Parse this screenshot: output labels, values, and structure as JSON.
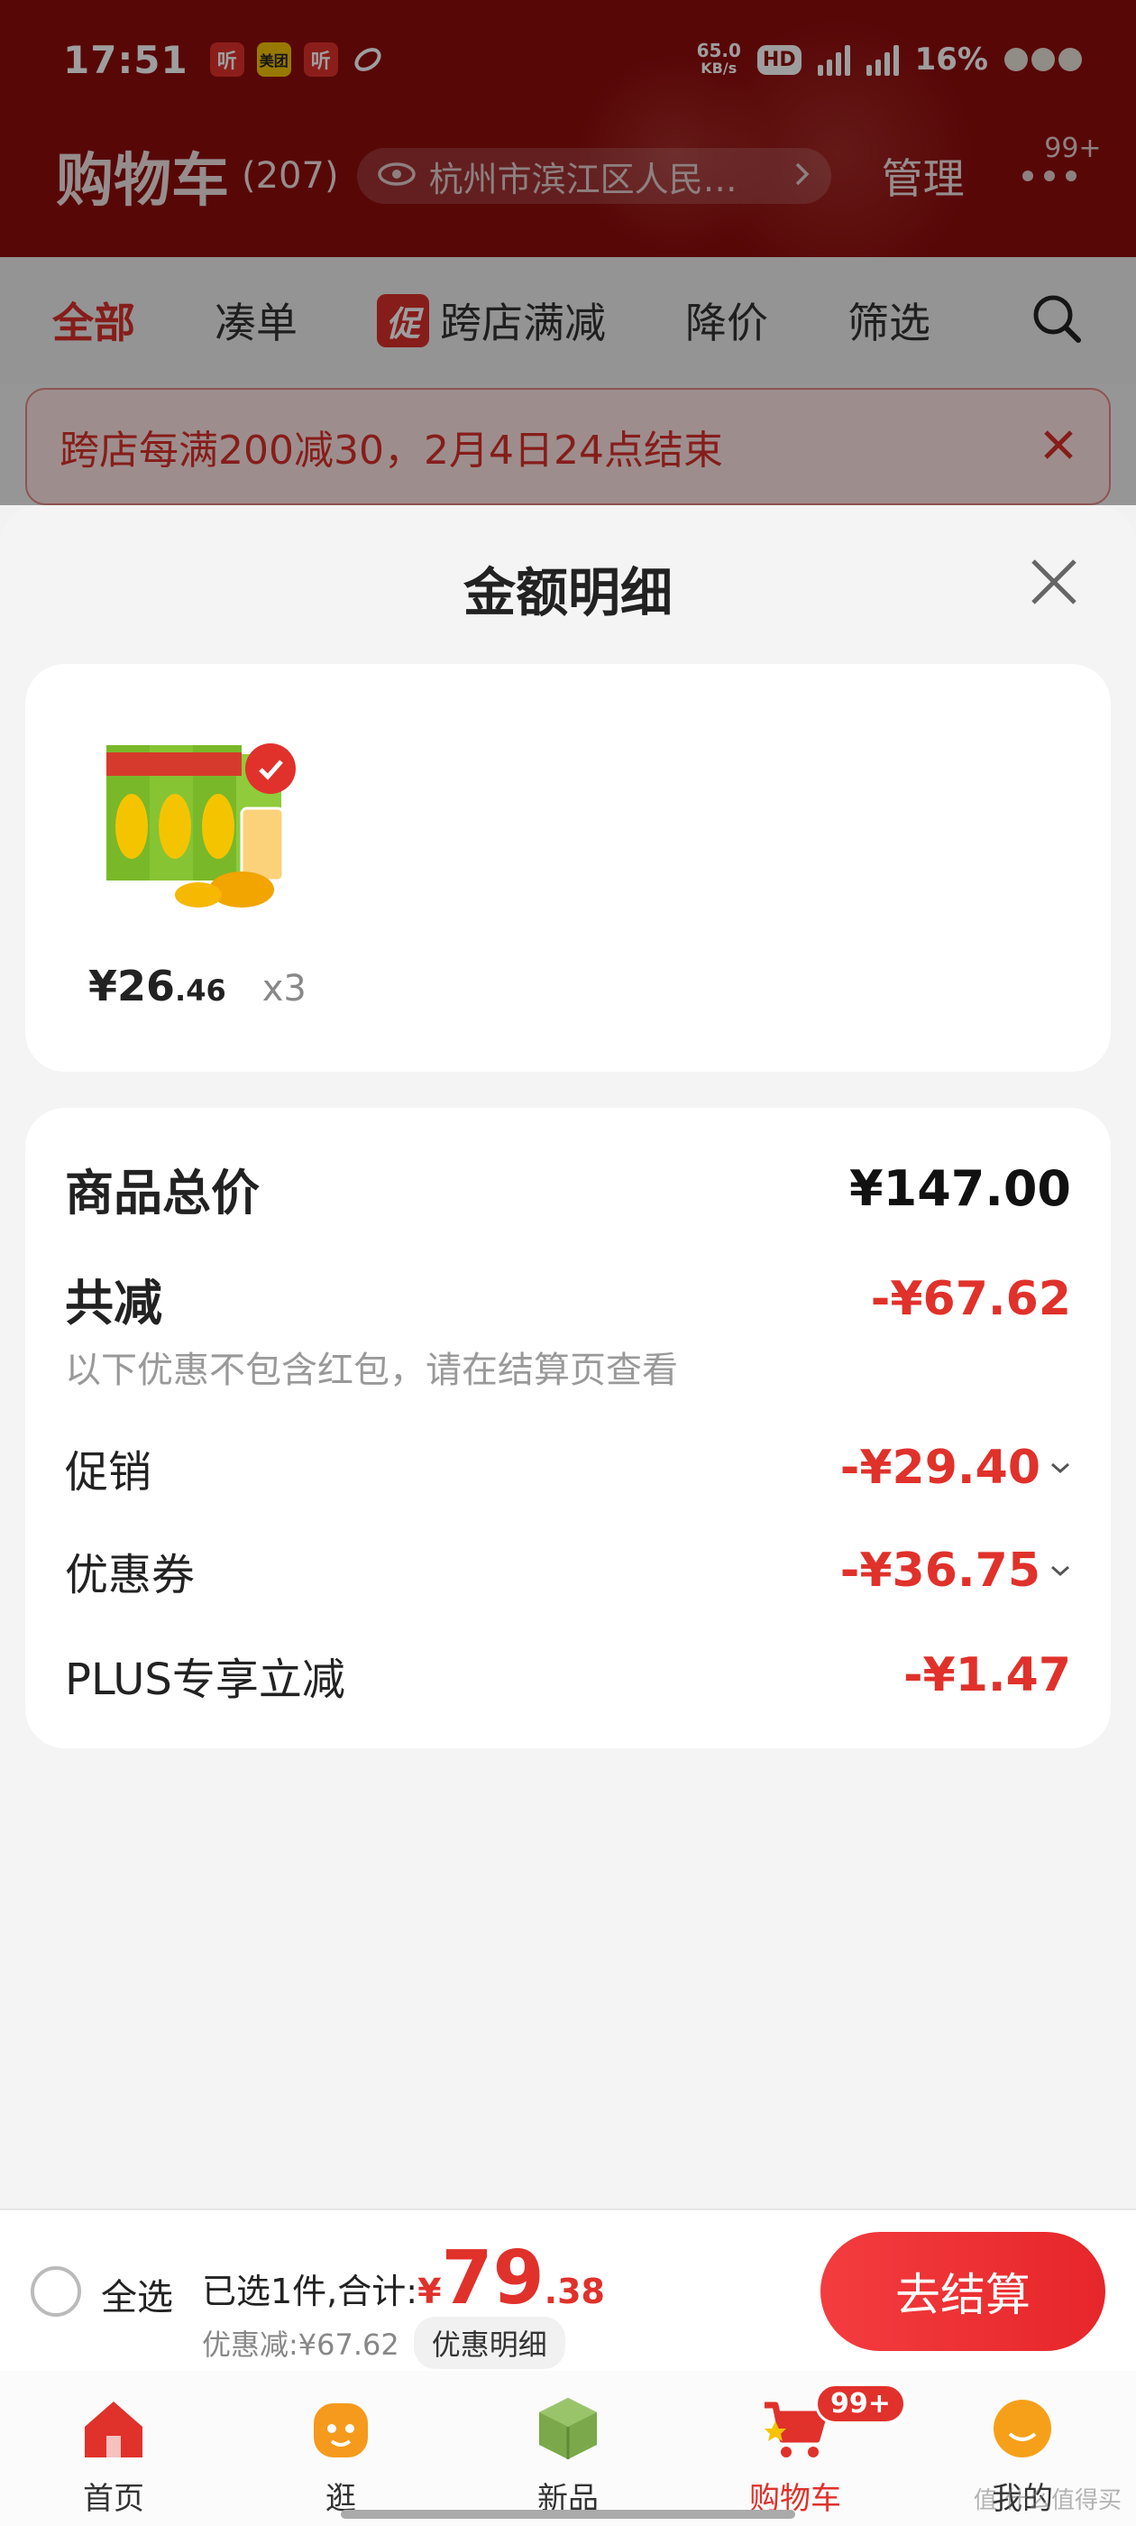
{
  "status_bar": {
    "time": "17:51",
    "app_icons": [
      "听",
      "美团",
      "听"
    ],
    "net_speed_value": "65.0",
    "net_speed_unit": "KB/s",
    "hd": "HD",
    "battery": "16%"
  },
  "header": {
    "title": "购物车",
    "count": "(207)",
    "location": "杭州市滨江区人民…",
    "manage": "管理",
    "more_badge": "99+"
  },
  "tabs": {
    "all": "全部",
    "bundle": "凑单",
    "promo_tag": "促",
    "cross_store": "跨店满减",
    "price_drop": "降价",
    "filter": "筛选"
  },
  "banner": {
    "text": "跨店每满200减30，2月4日24点结束"
  },
  "sheet": {
    "title": "金额明细",
    "product": {
      "price_symbol": "¥",
      "price_int": "26",
      "price_dec": ".46",
      "quantity": "x3"
    },
    "details": {
      "total_label": "商品总价",
      "total_value": "¥147.00",
      "reduce_label": "共减",
      "reduce_value": "-¥67.62",
      "reduce_note": "以下优惠不包含红包，请在结算页查看",
      "promo_label": "促销",
      "promo_value": "-¥29.40",
      "coupon_label": "优惠券",
      "coupon_value": "-¥36.75",
      "plus_label": "PLUS专享立减",
      "plus_value": "-¥1.47"
    }
  },
  "checkout": {
    "select_all": "全选",
    "summary_label": "已选1件,合计:",
    "total_symbol": "¥",
    "total_int": "79",
    "total_dec": ".38",
    "discount_text": "优惠减:¥67.62",
    "discount_button": "优惠明细",
    "pay_button": "去结算"
  },
  "tabbar": {
    "items": [
      {
        "label": "首页",
        "icon": "home-icon"
      },
      {
        "label": "逛",
        "icon": "browse-icon"
      },
      {
        "label": "新品",
        "icon": "new-products-icon"
      },
      {
        "label": "购物车",
        "icon": "cart-icon"
      },
      {
        "label": "我的",
        "icon": "profile-icon"
      }
    ],
    "cart_badge": "99+"
  },
  "watermark": "值 什么值得买",
  "colors": {
    "header_bg": "#8e0c0c",
    "accent_red": "#e0312b",
    "pay_button": "#f43c3f"
  }
}
